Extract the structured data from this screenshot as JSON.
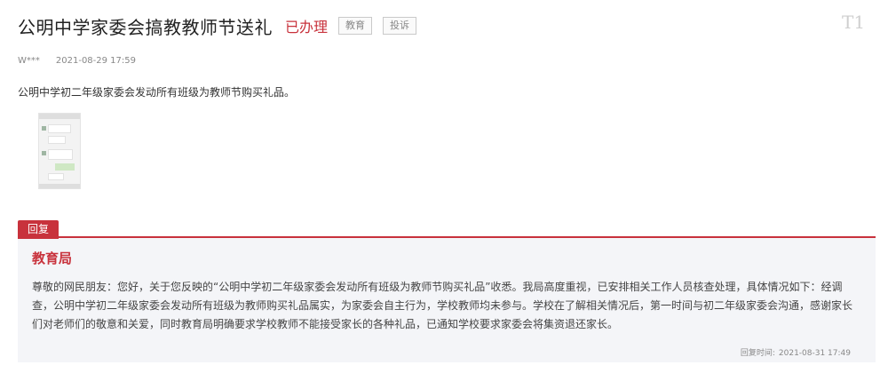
{
  "header": {
    "title": "公明中学家委会搞教教师节送礼",
    "status": "已办理",
    "tags": [
      "教育",
      "投诉"
    ],
    "font_button": "T1"
  },
  "meta": {
    "author": "W***",
    "time": "2021-08-29 17:59"
  },
  "content": {
    "text": "公明中学初二年级家委会发动所有班级为教师节购买礼品。",
    "attachment_icon": "image-thumbnail"
  },
  "reply": {
    "tab_label": "回复",
    "org": "教育局",
    "text": "尊敬的网民朋友：您好，关于您反映的“公明中学初二年级家委会发动所有班级为教师节购买礼品”收悉。我局高度重视，已安排相关工作人员核查处理，具体情况如下：经调查，公明中学初二年级家委会发动所有班级为教师购买礼品属实，为家委会自主行为，学校教师均未参与。学校在了解相关情况后，第一时间与初二年级家委会沟通，感谢家长们对老师们的敬意和关爱，同时教育局明确要求学校教师不能接受家长的各种礼品，已通知学校要求家委会将集资退还家长。",
    "time_label": "回复时间:",
    "time": "2021-08-31 17:49"
  },
  "colors": {
    "accent": "#c8323c",
    "reply_bg": "#f4f5f8",
    "tag_border": "#c9c9c9"
  }
}
